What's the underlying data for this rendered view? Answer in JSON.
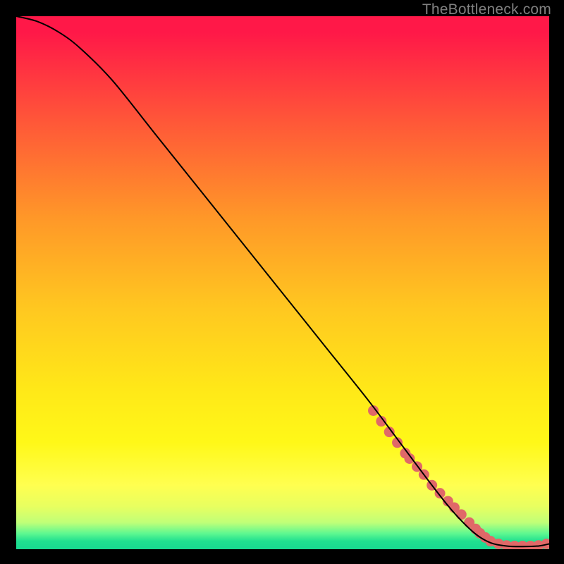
{
  "watermark": "TheBottleneck.com",
  "chart_data": {
    "type": "line",
    "title": "",
    "xlabel": "",
    "ylabel": "",
    "xlim": [
      0,
      100
    ],
    "ylim": [
      0,
      100
    ],
    "series": [
      {
        "name": "curve",
        "x": [
          0,
          4,
          8,
          12,
          18,
          26,
          34,
          42,
          50,
          58,
          66,
          72,
          78,
          82,
          86,
          89,
          92,
          95,
          98,
          100
        ],
        "y": [
          100,
          99,
          97,
          94,
          88,
          78,
          68,
          58,
          48,
          38,
          28,
          20,
          12,
          7,
          3,
          1.2,
          0.6,
          0.5,
          0.6,
          1.0
        ]
      },
      {
        "name": "highlight-dots",
        "x": [
          67,
          68.5,
          70,
          71.5,
          73,
          73.8,
          75.2,
          76.5,
          78,
          79.5,
          81,
          82.2,
          83.5,
          85,
          86.2,
          87,
          88,
          89,
          90.5,
          92,
          93.5,
          95,
          96.5,
          98,
          99.5
        ],
        "y": [
          26,
          24,
          22,
          20,
          18,
          17,
          15.5,
          14,
          12,
          10.5,
          9,
          7.8,
          6.5,
          5,
          3.8,
          3.0,
          2.2,
          1.5,
          1.0,
          0.7,
          0.6,
          0.6,
          0.6,
          0.7,
          1.0
        ]
      }
    ],
    "colors": {
      "curve": "#000000",
      "dots": "#e06868"
    }
  }
}
